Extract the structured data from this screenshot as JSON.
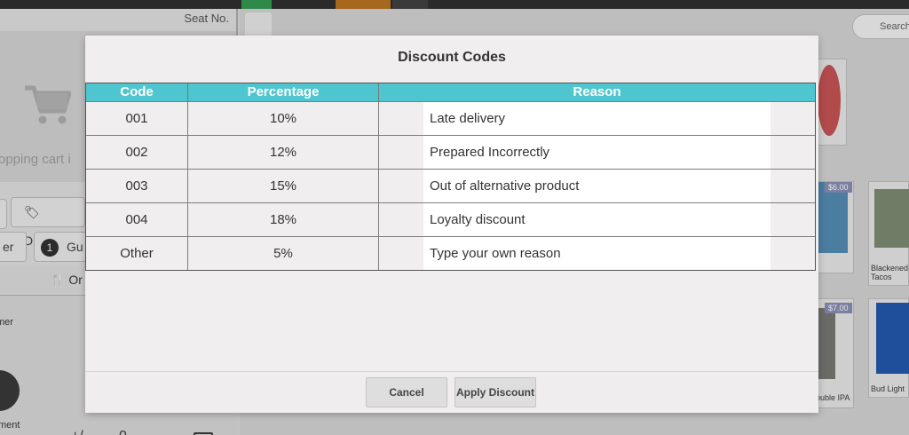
{
  "background": {
    "seat_label": "Seat No.",
    "cart_text": "opping cart i",
    "discount_chip": "Discoun",
    "guest_chip": "Gu",
    "guest_count": "1",
    "er_chip": "er",
    "order_chip": "Or",
    "customer_label": "mer",
    "payment_label": "ment",
    "plus_minus": "+/-",
    "zero_key": "0",
    "search_placeholder": "Search",
    "tiles": [
      {
        "price": "$6.00",
        "name": "Blackened Tacos"
      },
      {
        "price": "$7.00",
        "name": "ouble IPA"
      },
      {
        "price": "",
        "name": "Bud Light"
      }
    ]
  },
  "modal": {
    "title": "Discount Codes",
    "columns": [
      "Code",
      "Percentage",
      "Reason"
    ],
    "rows": [
      {
        "code": "001",
        "percentage": "10%",
        "reason": "Late delivery"
      },
      {
        "code": "002",
        "percentage": "12%",
        "reason": "Prepared Incorrectly"
      },
      {
        "code": "003",
        "percentage": "15%",
        "reason": "Out of alternative product"
      },
      {
        "code": "004",
        "percentage": "18%",
        "reason": "Loyalty discount"
      },
      {
        "code": "Other",
        "percentage": "5%",
        "reason": "Type your own reason"
      }
    ],
    "buttons": {
      "cancel": "Cancel",
      "apply": "Apply Discount"
    }
  },
  "colors": {
    "header_accent": "#4fc6cf"
  }
}
